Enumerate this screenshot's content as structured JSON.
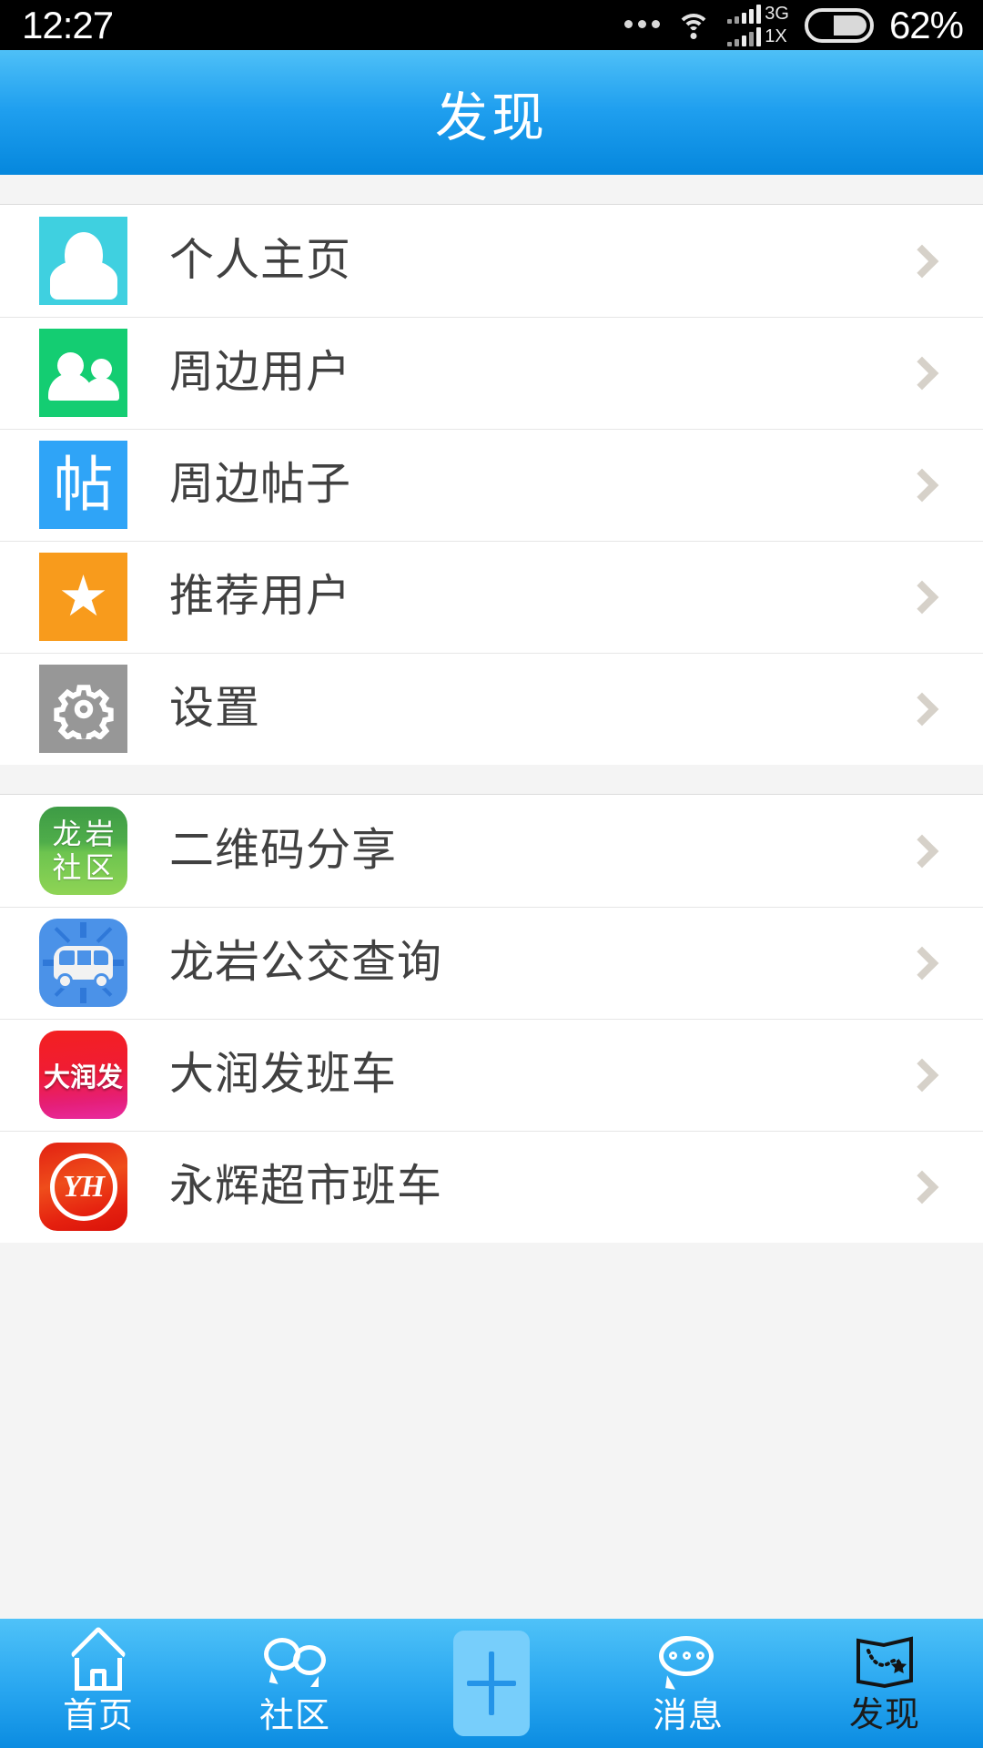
{
  "status_bar": {
    "time": "12:27",
    "network_label_top": "3G",
    "network_label_bottom": "1X",
    "battery_percent": "62%",
    "icons": [
      "more-dots-icon",
      "wifi-icon",
      "signal-bars-icon",
      "battery-icon"
    ]
  },
  "header": {
    "title": "发现",
    "gradient_top": "#4ec0f7",
    "gradient_bottom": "#0587dd"
  },
  "groups": [
    {
      "id": "primary",
      "items": [
        {
          "label": "个人主页",
          "icon": "person-avatar-icon",
          "icon_color": "#3fd0e0",
          "chevron": "chevron-right-icon"
        },
        {
          "label": "周边用户",
          "icon": "two-users-icon",
          "icon_color": "#14cd72",
          "chevron": "chevron-right-icon"
        },
        {
          "label": "周边帖子",
          "icon": "post-glyph-icon",
          "icon_color": "#2fa4f7",
          "icon_text": "帖",
          "chevron": "chevron-right-icon"
        },
        {
          "label": "推荐用户",
          "icon": "star-icon",
          "icon_color": "#f89b1c",
          "icon_text": "★",
          "chevron": "chevron-right-icon"
        },
        {
          "label": "设置",
          "icon": "gear-icon",
          "icon_color": "#979797",
          "chevron": "chevron-right-icon"
        }
      ]
    },
    {
      "id": "services",
      "items": [
        {
          "label": "二维码分享",
          "icon": "longyan-community-app-icon",
          "icon_color": "#4fad4a",
          "icon_text": "龙岩社区",
          "chevron": "chevron-right-icon"
        },
        {
          "label": "龙岩公交查询",
          "icon": "bus-icon",
          "icon_color": "#4b92e8",
          "chevron": "chevron-right-icon"
        },
        {
          "label": "大润发班车",
          "icon": "rt-mart-app-icon",
          "icon_color": "#f01c34",
          "icon_text": "大润发",
          "chevron": "chevron-right-icon"
        },
        {
          "label": "永辉超市班车",
          "icon": "yonghui-app-icon",
          "icon_color": "#e22112",
          "icon_text": "YH",
          "chevron": "chevron-right-icon"
        }
      ]
    }
  ],
  "tabbar": {
    "active_index": 4,
    "accent_active": "#1b1b1b",
    "accent_inactive": "#ffffff",
    "tabs": [
      {
        "label": "首页",
        "icon": "home-icon"
      },
      {
        "label": "社区",
        "icon": "chat-bubbles-icon"
      },
      {
        "label": "",
        "icon": "plus-icon"
      },
      {
        "label": "消息",
        "icon": "message-bubble-icon"
      },
      {
        "label": "发现",
        "icon": "map-star-icon"
      }
    ]
  }
}
